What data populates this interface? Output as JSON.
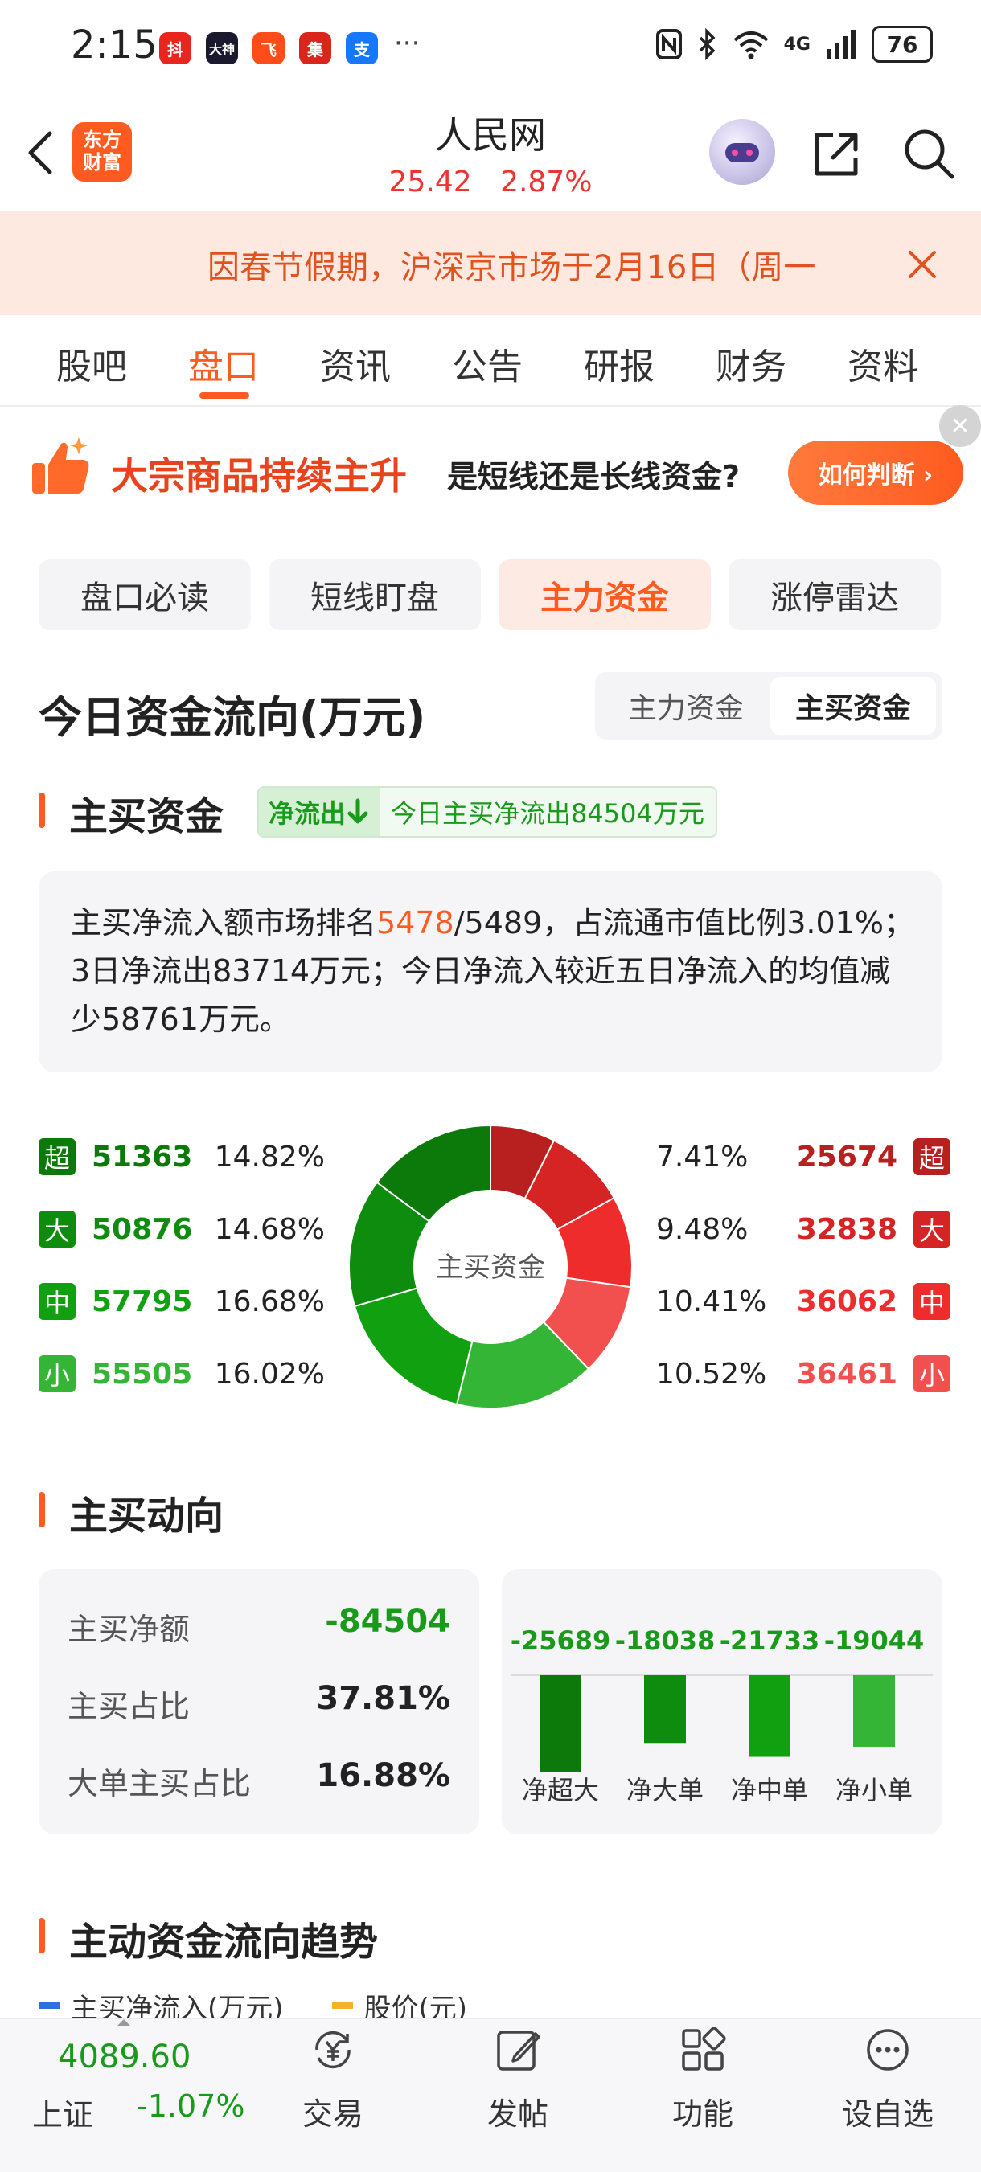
{
  "status_bar": {
    "time": "2:15",
    "app_icons": [
      "抖",
      "大神",
      "飞",
      "集",
      "支"
    ],
    "more": "···",
    "network": "4G",
    "battery": "76"
  },
  "header": {
    "brand_line1": "东方",
    "brand_line2": "财富",
    "title": "人民网",
    "price": "25.42",
    "change_pct": "2.87%"
  },
  "notice": {
    "text": "因春节假期，沪深京市场于2月16日（周一"
  },
  "tabs": [
    {
      "label": "股吧"
    },
    {
      "label": "盘口"
    },
    {
      "label": "资讯"
    },
    {
      "label": "公告"
    },
    {
      "label": "研报"
    },
    {
      "label": "财务"
    },
    {
      "label": "资料"
    }
  ],
  "banner": {
    "title": "大宗商品持续主升",
    "subtitle": "是短线还是长线资金?",
    "button": "如何判断 ›"
  },
  "subtabs": [
    {
      "label": "盘口必读"
    },
    {
      "label": "短线盯盘"
    },
    {
      "label": "主力资金"
    },
    {
      "label": "涨停雷达"
    }
  ],
  "flow": {
    "title": "今日资金流向(万元)",
    "toggle": [
      "主力资金",
      "主买资金"
    ]
  },
  "main_buy": {
    "heading": "主买资金",
    "tag": "净流出",
    "tag_text": "今日主买净流出84504万元",
    "summary_p1": "主买净流入额市场排名",
    "rank": "5478",
    "summary_p2": "/5489，占流通市值比例3.01%；3日净流出83714万元；今日净流入较近五日净流入的均值减少58761万元。"
  },
  "donut": {
    "center_label": "主买资金",
    "outflow": [
      {
        "badge": "超",
        "value": "51363",
        "pct": "14.82%",
        "share": 14.82,
        "color": "#0b7a0b"
      },
      {
        "badge": "大",
        "value": "50876",
        "pct": "14.68%",
        "share": 14.68,
        "color": "#0d8c0d"
      },
      {
        "badge": "中",
        "value": "57795",
        "pct": "16.68%",
        "share": 16.68,
        "color": "#10a010"
      },
      {
        "badge": "小",
        "value": "55505",
        "pct": "16.02%",
        "share": 16.02,
        "color": "#35b535"
      }
    ],
    "inflow": [
      {
        "badge": "超",
        "value": "25674",
        "pct": "7.41%",
        "share": 7.41,
        "color": "#b81f1f"
      },
      {
        "badge": "大",
        "value": "32838",
        "pct": "9.48%",
        "share": 9.48,
        "color": "#d62424"
      },
      {
        "badge": "中",
        "value": "36062",
        "pct": "10.41%",
        "share": 10.41,
        "color": "#ee2c2c"
      },
      {
        "badge": "小",
        "value": "36461",
        "pct": "10.52%",
        "share": 10.52,
        "color": "#f24f4f"
      }
    ]
  },
  "trend": {
    "heading": "主买动向",
    "stats": [
      {
        "label": "主买净额",
        "value": "-84504"
      },
      {
        "label": "主买占比",
        "value": "37.81%"
      },
      {
        "label": "大单主买占比",
        "value": "16.88%"
      }
    ],
    "bars": [
      {
        "label": "净超大",
        "value": "-25689",
        "num": -25689,
        "color": "#0b7a0b"
      },
      {
        "label": "净大单",
        "value": "-18038",
        "num": -18038,
        "color": "#0d8c0d"
      },
      {
        "label": "净中单",
        "value": "-21733",
        "num": -21733,
        "color": "#10a010"
      },
      {
        "label": "净小单",
        "value": "-19044",
        "num": -19044,
        "color": "#35b535"
      }
    ]
  },
  "trend2": {
    "heading": "主动资金流向趋势",
    "legend1": "主买净流入(万元)",
    "legend2": "股价(元)"
  },
  "bottom_nav": {
    "index_value": "4089.60",
    "index_name": "上证",
    "index_change": "-1.07%",
    "items": [
      {
        "label": "交易",
        "icon": "yen-exchange-icon"
      },
      {
        "label": "发帖",
        "icon": "edit-icon"
      },
      {
        "label": "功能",
        "icon": "grid-icon"
      },
      {
        "label": "设自选",
        "icon": "more-circle-icon"
      }
    ]
  }
}
